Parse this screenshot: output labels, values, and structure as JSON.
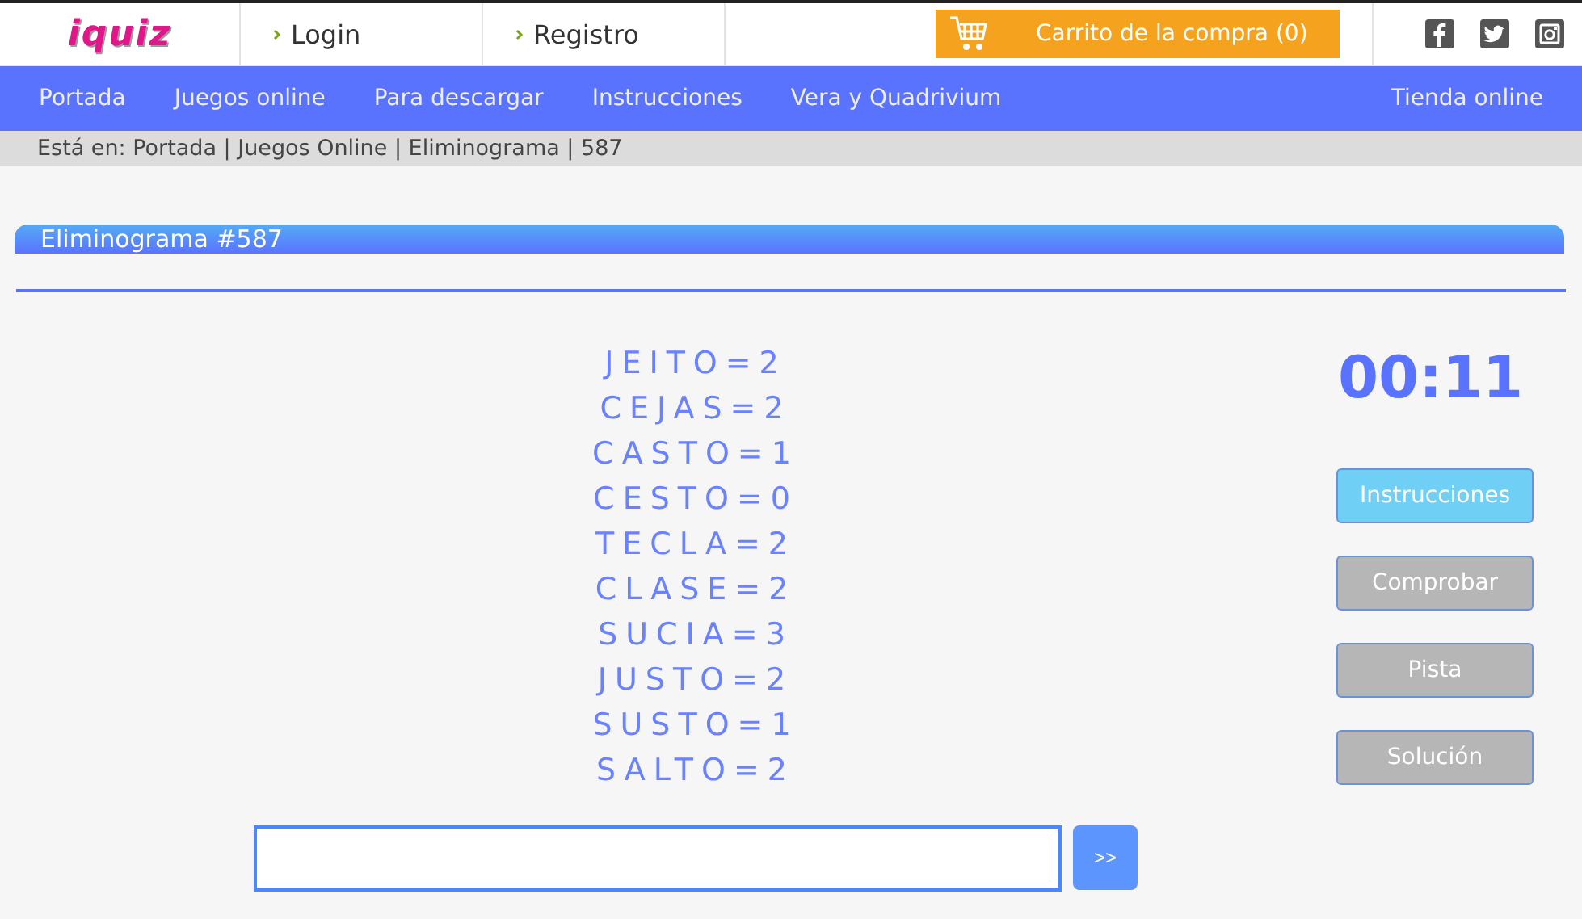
{
  "logo": {
    "text": "iquiz"
  },
  "top_links": [
    "Login",
    "Registro"
  ],
  "cart": {
    "label": "Carrito de la compra (0)"
  },
  "nav": {
    "items": [
      {
        "label": "Portada"
      },
      {
        "label": "Juegos online"
      },
      {
        "label": "Para descargar"
      },
      {
        "label": "Instrucciones"
      },
      {
        "label": "Vera y Quadrivium"
      }
    ],
    "right": "Tienda online"
  },
  "breadcrumb": "Está en: Portada | Juegos Online | Eliminograma | 587",
  "panel": {
    "title": "Eliminograma #587"
  },
  "clues": [
    "JEITO=2",
    "CEJAS=2",
    "CASTO=1",
    "CESTO=0",
    "TECLA=2",
    "CLASE=2",
    "SUCIA=3",
    "JUSTO=2",
    "SUSTO=1",
    "SALTO=2"
  ],
  "timer": "00:11",
  "buttons": [
    {
      "label": "Instrucciones",
      "kind": "primary"
    },
    {
      "label": "Comprobar",
      "kind": "secondary"
    },
    {
      "label": "Pista",
      "kind": "secondary"
    },
    {
      "label": "Solución",
      "kind": "secondary"
    }
  ],
  "submit": {
    "label": ">>"
  }
}
